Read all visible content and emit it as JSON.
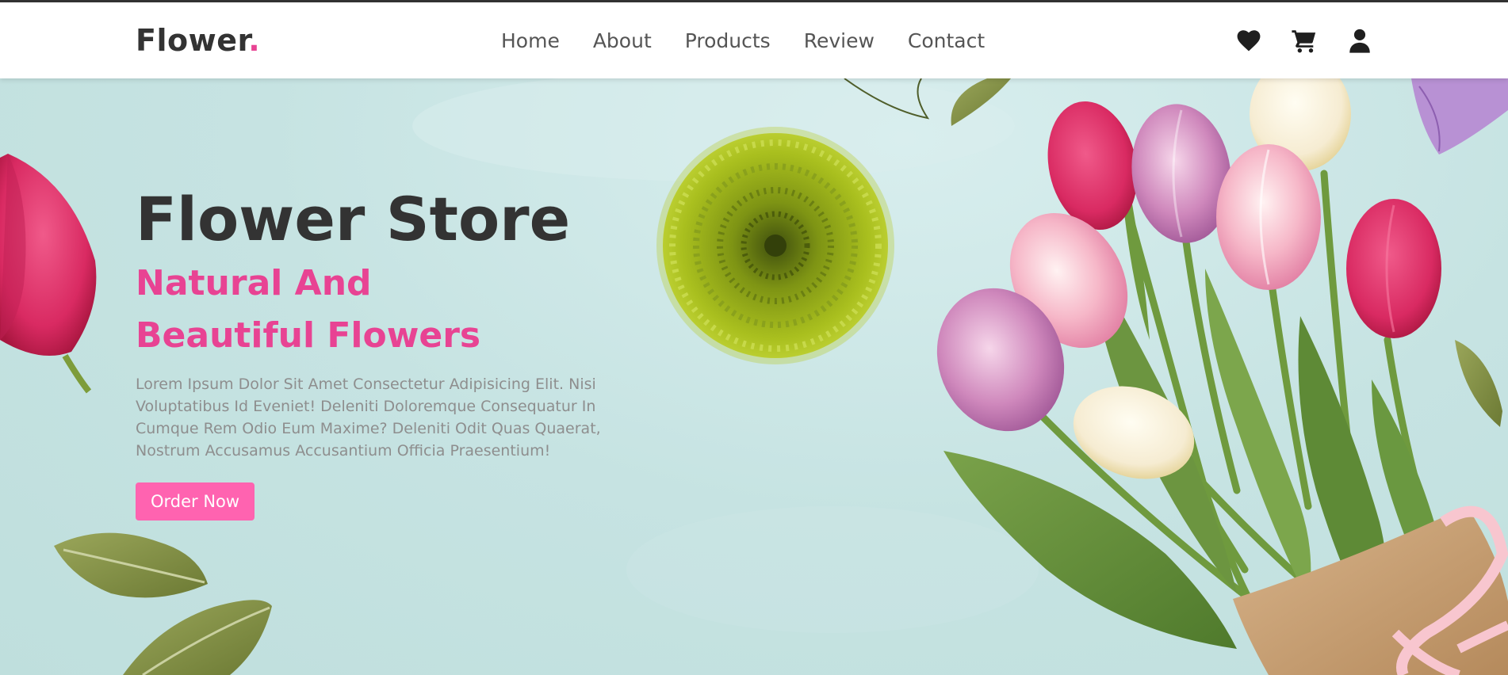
{
  "brand": {
    "name": "Flower",
    "dot": "."
  },
  "nav": [
    {
      "label": "Home"
    },
    {
      "label": "About"
    },
    {
      "label": "Products"
    },
    {
      "label": "Review"
    },
    {
      "label": "Contact"
    }
  ],
  "header_icons": [
    "heart-icon",
    "cart-icon",
    "user-icon"
  ],
  "hero": {
    "title": "Flower Store",
    "subtitle": "Natural And Beautiful Flowers",
    "description": "Lorem Ipsum Dolor Sit Amet Consectetur Adipisicing Elit. Nisi Voluptatibus Id Eveniet! Deleniti Doloremque Consequatur In Cumque Rem Odio Eum Maxime? Deleniti Odit Quas Quaerat, Nostrum Accusamus Accusantium Officia Praesentium!",
    "button": "Order Now"
  },
  "colors": {
    "accent": "#e84393",
    "button": "#ff63b0",
    "text_dark": "#333333",
    "hero_bg": "#c5e3e2"
  }
}
